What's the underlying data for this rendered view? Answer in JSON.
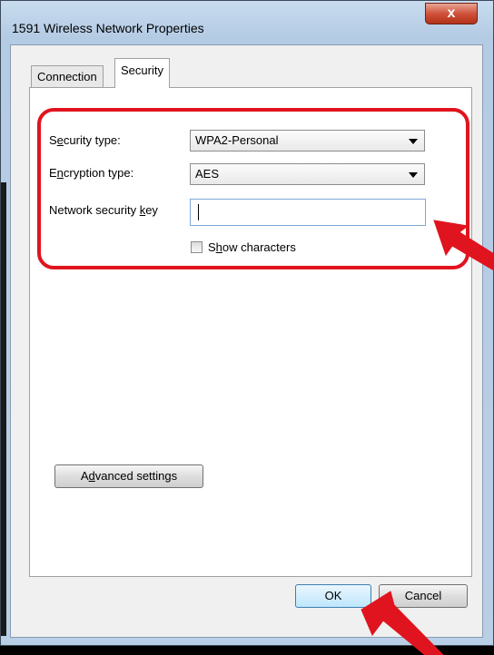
{
  "window": {
    "title": "1591 Wireless Network Properties",
    "close_label": "x"
  },
  "tabs": [
    {
      "label": "Connection"
    },
    {
      "label": "Security"
    }
  ],
  "security": {
    "security_type": {
      "label_pre": "S",
      "label_u": "e",
      "label_post": "curity type:",
      "value": "WPA2-Personal"
    },
    "encryption_type": {
      "label_pre": "E",
      "label_u": "n",
      "label_post": "cryption type:",
      "value": "AES"
    },
    "key": {
      "label_pre": "Network security ",
      "label_u": "k",
      "label_post": "ey",
      "value": ""
    },
    "show_characters": {
      "label_pre": "S",
      "label_u": "h",
      "label_post": "ow characters",
      "checked": false
    }
  },
  "buttons": {
    "advanced_pre": "A",
    "advanced_u": "d",
    "advanced_post": "vanced settings",
    "ok": "OK",
    "cancel": "Cancel"
  },
  "colors": {
    "highlight": "#e0141e",
    "arrow": "#e0141e"
  }
}
